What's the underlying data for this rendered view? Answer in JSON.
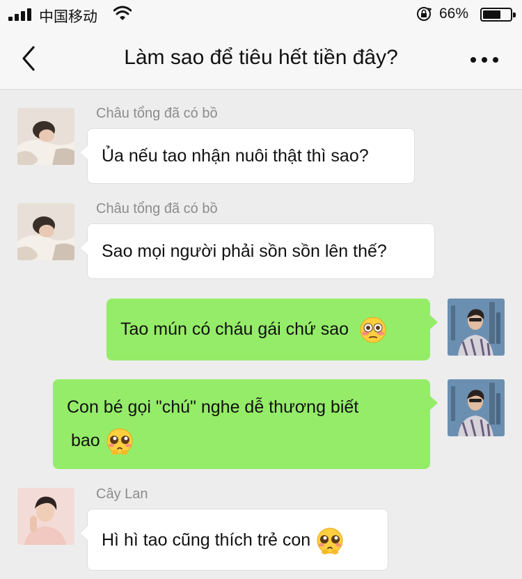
{
  "status_bar": {
    "carrier": "中国移动",
    "battery_percent": "66%",
    "battery_level": 0.66,
    "signal_bars": 4
  },
  "nav": {
    "title": "Làm sao để tiêu hết tiền đây?",
    "back_icon": "chevron-left-icon",
    "more_icon": "more-dots-icon"
  },
  "messages": [
    {
      "direction": "incoming",
      "sender": "Châu tổng đã có bồ",
      "text": "Ủa nếu tao nhận nuôi thật thì sao?"
    },
    {
      "direction": "incoming",
      "sender": "Châu tổng đã có bồ",
      "text": "Sao mọi người phải sồn sồn lên thế?"
    },
    {
      "direction": "outgoing",
      "text": "Tao mún có cháu gái chứ sao",
      "emoji": "flushed-face-emoji"
    },
    {
      "direction": "outgoing",
      "text_line1": "Con bé gọi \"chú\" nghe dễ thương biết",
      "text_line2": "bao",
      "emoji": "pleading-face-emoji"
    },
    {
      "direction": "incoming",
      "sender": "Cây Lan",
      "text": "Hì hì tao cũng thích trẻ con",
      "emoji": "pleading-face-emoji"
    }
  ],
  "colors": {
    "background": "#ededed",
    "bar": "#f7f7f7",
    "outgoing_bubble": "#95ec69",
    "incoming_bubble": "#ffffff",
    "sender_name": "#8c8c8c"
  }
}
